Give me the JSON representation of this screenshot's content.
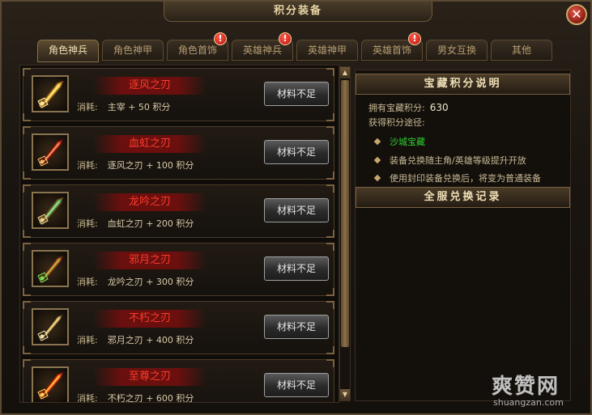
{
  "window": {
    "title": "积分装备"
  },
  "tabs": [
    {
      "label": "角色神兵",
      "active": true,
      "alert": false
    },
    {
      "label": "角色神甲",
      "active": false,
      "alert": false
    },
    {
      "label": "角色首饰",
      "active": false,
      "alert": true
    },
    {
      "label": "英雄神兵",
      "active": false,
      "alert": true
    },
    {
      "label": "英雄神甲",
      "active": false,
      "alert": false
    },
    {
      "label": "英雄首饰",
      "active": false,
      "alert": true
    },
    {
      "label": "男女互换",
      "active": false,
      "alert": false
    },
    {
      "label": "其他",
      "active": false,
      "alert": false
    }
  ],
  "badge_text": "!",
  "items": [
    {
      "name": "逐风之刃",
      "cost_label": "消耗:",
      "cost": "主宰 + 50 积分",
      "button": "材料不足",
      "icon": "golden-sword-icon"
    },
    {
      "name": "血虹之刃",
      "cost_label": "消耗:",
      "cost": "逐风之刃 + 100 积分",
      "button": "材料不足",
      "icon": "red-blade-icon"
    },
    {
      "name": "龙吟之刃",
      "cost_label": "消耗:",
      "cost": "血虹之刃 + 200 积分",
      "button": "材料不足",
      "icon": "jade-sword-icon"
    },
    {
      "name": "邪月之刃",
      "cost_label": "消耗:",
      "cost": "龙吟之刃 + 300 积分",
      "button": "材料不足",
      "icon": "moon-blade-icon"
    },
    {
      "name": "不朽之刃",
      "cost_label": "消耗:",
      "cost": "邪月之刃 + 400 积分",
      "button": "材料不足",
      "icon": "dark-gold-sword-icon"
    },
    {
      "name": "至尊之刃",
      "cost_label": "消耗:",
      "cost": "不朽之刃 + 600 积分",
      "button": "材料不足",
      "icon": "flame-sword-icon"
    }
  ],
  "right_panel": {
    "header": "宝藏积分说明",
    "points_label": "拥有宝藏积分:",
    "points_value": "630",
    "ways_label": "获得积分途径:",
    "ways": [
      {
        "text": "沙城宝藏",
        "highlight": true
      },
      {
        "text": "装备兑换随主角/英雄等级提升开放",
        "highlight": false
      },
      {
        "text": "使用封印装备兑换后，将变为普通装备",
        "highlight": false
      }
    ],
    "record_header": "全服兑换记录"
  },
  "watermark": {
    "main": "爽赞网",
    "sub": "shuangzan.com"
  },
  "colors": {
    "item_name": "#ff3a2a",
    "highlight_way": "#2fd12f",
    "frame_gold": "#8a7048"
  }
}
